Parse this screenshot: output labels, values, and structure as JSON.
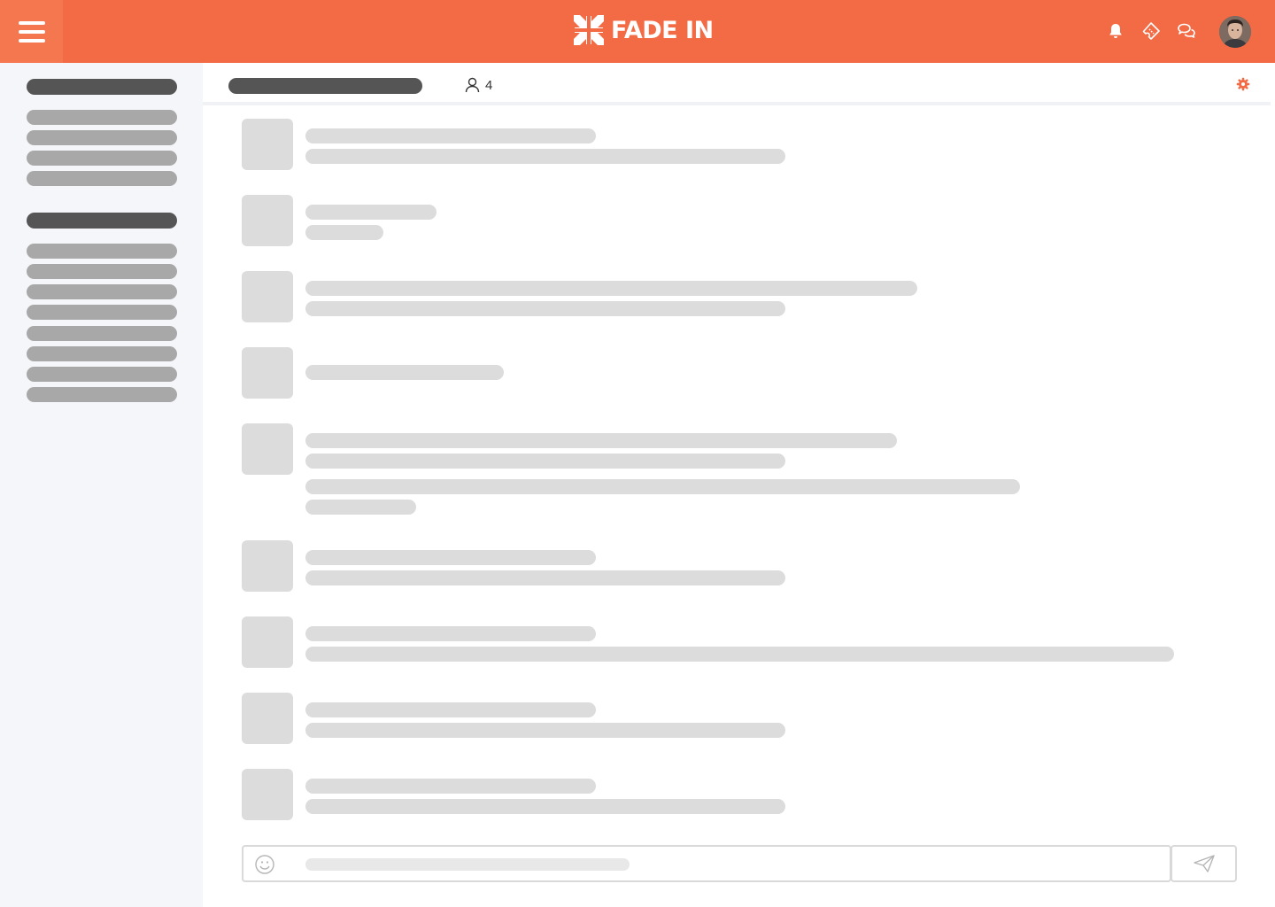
{
  "app": {
    "logo_text": "FADE IN",
    "brand_color": "#f36b45"
  },
  "topbar": {
    "menu_icon": "hamburger-icon",
    "icons": [
      "bell-icon",
      "ticket-icon",
      "chat-bubbles-icon"
    ],
    "avatar": "user-avatar"
  },
  "channel": {
    "member_count": "4",
    "member_icon": "person-icon",
    "settings_icon": "gear-icon"
  },
  "composer": {
    "emoji_icon": "smiley-icon",
    "send_icon": "paper-plane-icon"
  },
  "state": "loading-skeleton"
}
